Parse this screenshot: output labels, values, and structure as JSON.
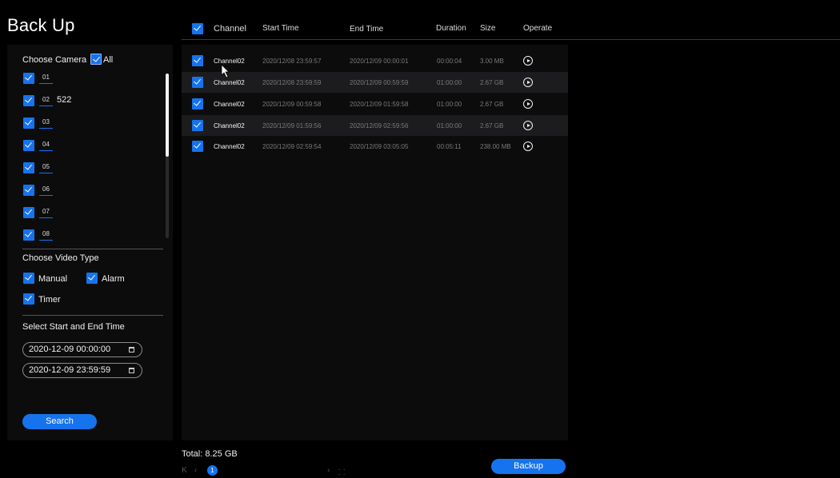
{
  "page": {
    "title": "Back Up"
  },
  "sidebar": {
    "camera_label": "Choose Camera",
    "all_label": "All",
    "cameras": [
      {
        "num": "01",
        "name": ""
      },
      {
        "num": "02",
        "name": "522"
      },
      {
        "num": "03",
        "name": ""
      },
      {
        "num": "04",
        "name": ""
      },
      {
        "num": "05",
        "name": ""
      },
      {
        "num": "06",
        "name": ""
      },
      {
        "num": "07",
        "name": ""
      },
      {
        "num": "08",
        "name": ""
      }
    ],
    "video_type_label": "Choose Video Type",
    "video_types": {
      "manual": "Manual",
      "alarm": "Alarm",
      "timer": "Timer"
    },
    "time_label": "Select Start and End Time",
    "start_time": "2020-12-09 00:00:00",
    "end_time": "2020-12-09 23:59:59",
    "search_label": "Search"
  },
  "table": {
    "headers": {
      "channel": "Channel",
      "start_time": "Start Time",
      "end_time": "End Time",
      "duration": "Duration",
      "size": "Size",
      "operate": "Operate"
    },
    "rows": [
      {
        "channel": "Channel02",
        "start": "2020/12/08 23:59:57",
        "end": "2020/12/09 00:00:01",
        "duration": "00:00:04",
        "size": "3.00 MB"
      },
      {
        "channel": "Channel02",
        "start": "2020/12/08 23:59:59",
        "end": "2020/12/09 00:59:59",
        "duration": "01:00:00",
        "size": "2.67 GB"
      },
      {
        "channel": "Channel02",
        "start": "2020/12/09 00:59:58",
        "end": "2020/12/09 01:59:58",
        "duration": "01:00:00",
        "size": "2.67 GB"
      },
      {
        "channel": "Channel02",
        "start": "2020/12/09 01:59:56",
        "end": "2020/12/09 02:59:56",
        "duration": "01:00:00",
        "size": "2.67 GB"
      },
      {
        "channel": "Channel02",
        "start": "2020/12/09 02:59:54",
        "end": "2020/12/09 03:05:05",
        "duration": "00:05:11",
        "size": "238.00 MB"
      }
    ]
  },
  "footer": {
    "total": "Total: 8.25 GB",
    "current_page": "1",
    "backup_label": "Backup"
  },
  "colors": {
    "accent": "#1673ee",
    "background": "#000000",
    "panel": "#0c0c0d",
    "row_alt": "#1c1c1e"
  }
}
